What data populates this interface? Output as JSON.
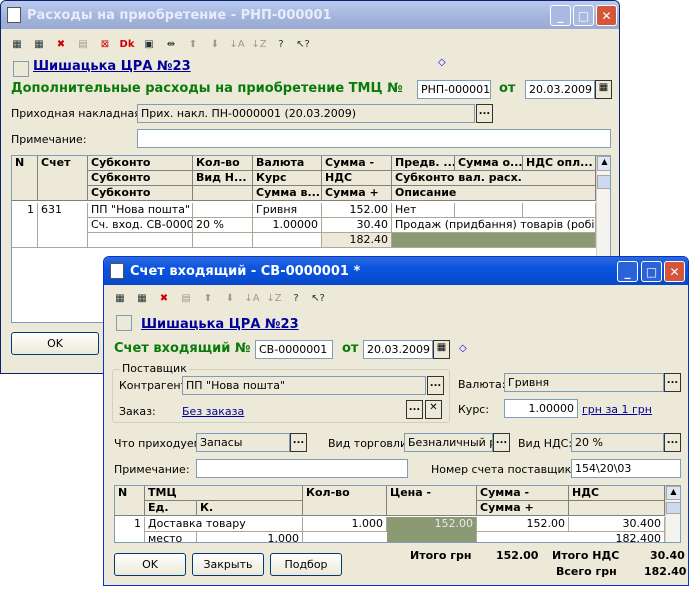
{
  "win1": {
    "title": "Расходы на приобретение - РНП-000001",
    "org": "Шишацька ЦРА №23",
    "doc_title": "Дополнительные расходы на приобретение ТМЦ №",
    "doc_number": "РНП-000001",
    "from_label": "от",
    "doc_date": "20.03.2009",
    "invoice_label": "Приходная накладная:",
    "invoice_value": "Прих. накл. ПН-0000001 (20.03.2009)",
    "note_label": "Примечание:",
    "note_value": "",
    "headers": {
      "n": "N",
      "account": "Счет",
      "subkonto1": "Субконто",
      "subkonto2": "Субконто",
      "subkonto3": "Субконто",
      "qty": "Кол-во",
      "vid": "Вид Н...",
      "currency": "Валюта",
      "rate": "Курс",
      "sum_cur": "Сумма в...",
      "sum": "Сумма -",
      "vat": "НДС",
      "sum_plus": "Сумма +",
      "pred": "Предв. ...",
      "sum_o": "Сумма о...",
      "vat_opl": "НДС опл...",
      "subk_val": "Субконто вал. расх.",
      "desc": "Описание"
    },
    "row": {
      "n": "1",
      "account": "631",
      "sub1": "ПП \"Нова пошта\"",
      "sub2": "Сч. вход. СВ-000000",
      "qty": "",
      "vid": "20 %",
      "currency": "Гривня",
      "rate": "1.00000",
      "sum": "152.00",
      "vat": "30.40",
      "sum_plus": "182.40",
      "pred": "Нет",
      "desc": "Продаж (придбання) товарів (робіт, пос"
    },
    "ok": "OK"
  },
  "win2": {
    "title": "Счет входящий - СВ-0000001 *",
    "org": "Шишацька ЦРА №23",
    "doc_title": "Счет входящий №",
    "doc_number": "СВ-0000001",
    "from_label": "от",
    "doc_date": "20.03.2009",
    "supplier_group": "Поставщик",
    "contractor_label": "Контрагент:",
    "contractor_value": "ПП \"Нова пошта\"",
    "order_label": "Заказ:",
    "order_value": "Без заказа",
    "currency_label": "Валюта:",
    "currency_value": "Гривня",
    "rate_label": "Курс:",
    "rate_value": "1.00000",
    "rate_unit": "грн за 1 грн",
    "incoming_label": "Что приходуем:",
    "incoming_value": "Запасы",
    "trade_label": "Вид торговли:",
    "trade_value": "Безналичный ра",
    "vat_type_label": "Вид НДС:",
    "vat_type_value": "20 %",
    "note_label": "Примечание:",
    "note_value": "",
    "supplier_inv_label": "Номер счета поставщика:",
    "supplier_inv_value": "154\\20\\03",
    "headers": {
      "n": "N",
      "tmc": "ТМЦ",
      "unit": "Ед.",
      "k": "К.",
      "qty": "Кол-во",
      "price": "Цена -",
      "sum": "Сумма -",
      "sum_plus": "Сумма +",
      "vat": "НДС"
    },
    "row": {
      "n": "1",
      "tmc": "Доставка товару",
      "unit": "место",
      "k": "1.000",
      "qty": "1.000",
      "price": "152.00",
      "sum": "152.00",
      "vat": "30.400",
      "sum_plus": "182.400"
    },
    "total_label": "Итого грн",
    "total_value": "152.00",
    "total_vat_label": "Итого НДС",
    "total_vat_value": "30.40",
    "grand_label": "Всего грн",
    "grand_value": "182.40",
    "ok": "OK",
    "close": "Закрыть",
    "select": "Подбор"
  },
  "colors": {
    "active_title": "#0a54e3",
    "inactive_title": "#a3b4dc",
    "link": "#00009c",
    "highlight": "#8c9a73"
  }
}
